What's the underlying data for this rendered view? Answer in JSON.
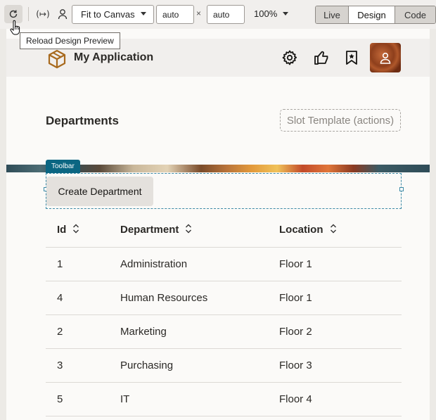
{
  "toolbar": {
    "fit_label": "Fit to Canvas",
    "width_value": "auto",
    "height_value": "auto",
    "times_symbol": "×",
    "zoom": "100%",
    "modes": [
      "Live",
      "Design",
      "Code"
    ],
    "selected_mode": "Design",
    "vars_symbol": "(↦)"
  },
  "tooltip": "Reload Design Preview",
  "app": {
    "title": "My Application"
  },
  "page": {
    "title": "Departments",
    "slot_label": "Slot Template (actions)",
    "toolbar_tag": "Toolbar",
    "create_button": "Create Department"
  },
  "table": {
    "columns": [
      "Id",
      "Department",
      "Location"
    ],
    "rows": [
      [
        "1",
        "Administration",
        "Floor 1"
      ],
      [
        "4",
        "Human Resources",
        "Floor 1"
      ],
      [
        "2",
        "Marketing",
        "Floor 2"
      ],
      [
        "3",
        "Purchasing",
        "Floor 3"
      ],
      [
        "5",
        "IT",
        "Floor 4"
      ]
    ]
  }
}
